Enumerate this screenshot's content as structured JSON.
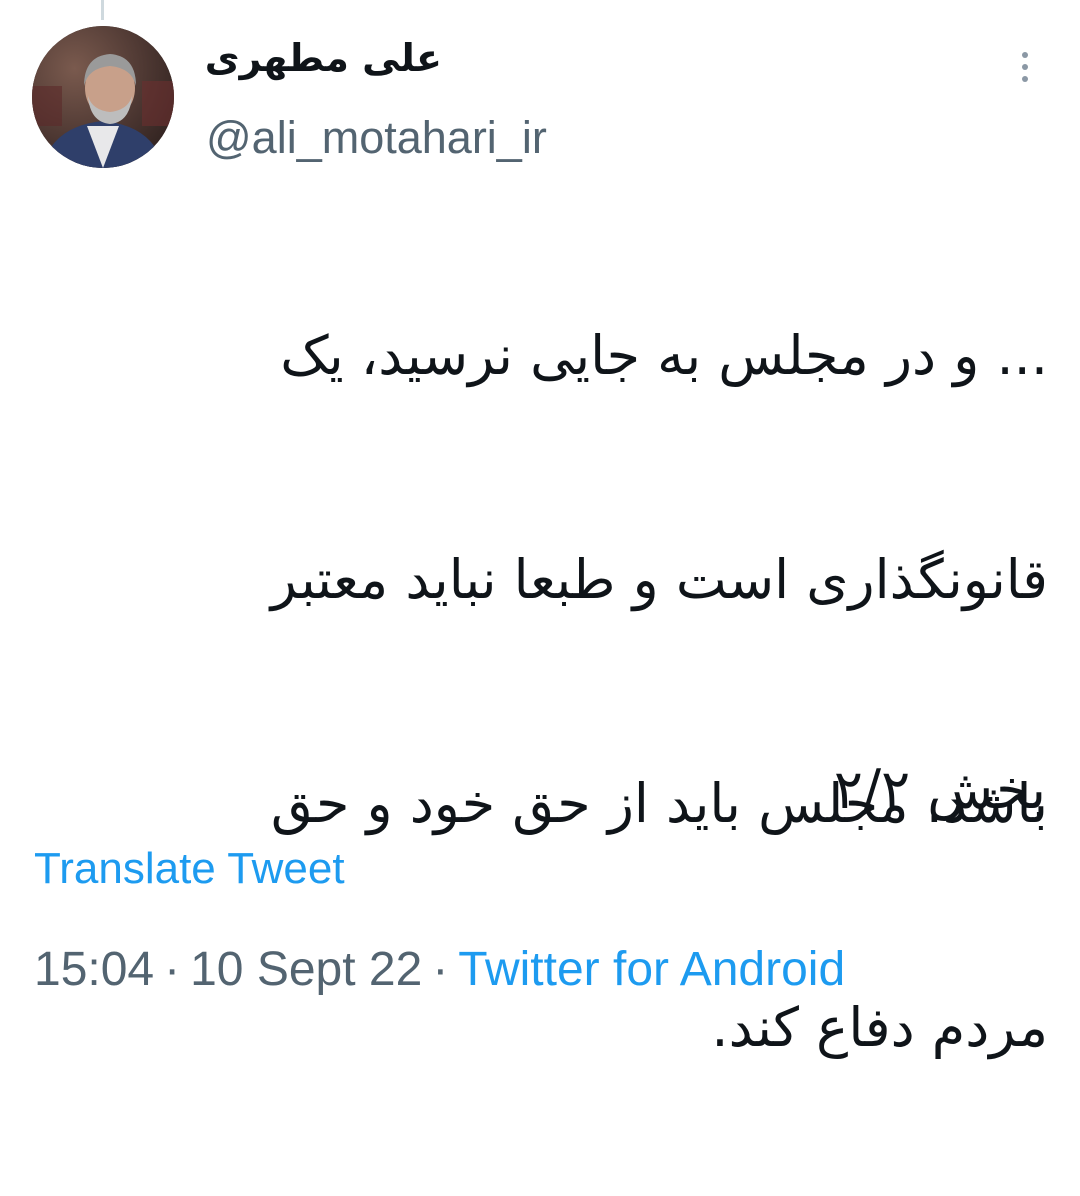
{
  "tweet": {
    "display_name": "علی مطهری",
    "handle": "@ali_motahari_ir",
    "text_lines": [
      "... و در مجلس به جایی نرسید، یک",
      "قانونگذاری است و طبعا نباید معتبر",
      "باشد. مجلس باید از حق خود و حق",
      "مردم دفاع کند."
    ],
    "part_label": "بخش ۲/۲",
    "translate_label": "Translate Tweet",
    "time": "15:04",
    "date": "10 Sept 22",
    "separator": "·",
    "source": "Twitter for Android"
  },
  "icons": {
    "more": "more-vertical-icon",
    "avatar": "avatar-photo"
  },
  "colors": {
    "text": "#0f1419",
    "secondary": "#536471",
    "link": "#1d9bf0",
    "thread_line": "#cfd9de"
  }
}
